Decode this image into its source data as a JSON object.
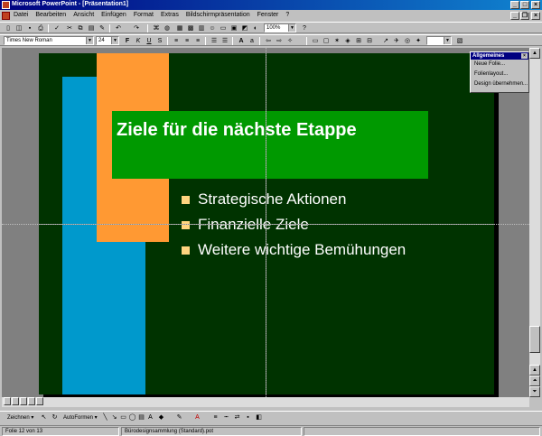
{
  "window": {
    "title": "Microsoft PowerPoint - [Präsentation1]",
    "controls": {
      "minimize": "_",
      "maximize": "□",
      "close": "×"
    }
  },
  "doc_controls": {
    "minimize": "_",
    "restore": "❐",
    "close": "×"
  },
  "menu": [
    "Datei",
    "Bearbeiten",
    "Ansicht",
    "Einfügen",
    "Format",
    "Extras",
    "Bildschirmpräsentation",
    "Fenster",
    "?"
  ],
  "toolbar_standard": {
    "zoom": "100%"
  },
  "toolbar_format": {
    "font": "Times New Roman",
    "size": "24"
  },
  "slide": {
    "title": "Ziele für die nächste Etappe",
    "bullets": [
      "Strategische Aktionen",
      "Finanzielle Ziele",
      "Weitere wichtige Bemühungen"
    ],
    "colors": {
      "background": "#003300",
      "title_box": "#009900",
      "bar_orange": "#ff9933",
      "bar_blue": "#0099cc",
      "bullet": "#ffd580"
    }
  },
  "palette": {
    "title": "Allgemeines",
    "items": [
      "Neue Folie...",
      "Folienlayout...",
      "Design übernehmen..."
    ]
  },
  "drawing_toolbar": {
    "zoom_label": "Zeichnen ▾",
    "autoshapes_label": "AutoFormen ▾"
  },
  "statusbar": {
    "slide_info": "Folie 12 von 13",
    "template": "Bürodesignsammlung (Standard).pot"
  },
  "icons": {
    "new": "new-document-icon",
    "open": "open-folder-icon",
    "save": "save-icon",
    "print": "print-icon",
    "bold": "bold-icon",
    "italic": "italic-icon",
    "underline": "underline-icon"
  }
}
